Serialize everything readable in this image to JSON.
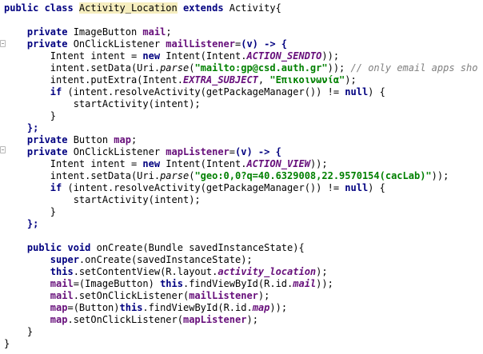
{
  "editor": {
    "language": "java",
    "colors": {
      "keyword": "#000080",
      "field": "#660e7a",
      "string": "#008000",
      "comment": "#808080",
      "highlight": "#f6eebf",
      "background": "#ffffff"
    },
    "lines": [
      [
        [
          "kw",
          "public class "
        ],
        [
          "hl",
          "Activity_Location"
        ],
        [
          "kw",
          " extends "
        ],
        [
          "",
          "Activity{"
        ]
      ],
      [],
      [
        [
          "",
          "    "
        ],
        [
          "kw",
          "private "
        ],
        [
          "",
          "ImageButton "
        ],
        [
          "fld",
          "mail"
        ],
        [
          ";"
        ]
      ],
      [
        [
          "",
          "    "
        ],
        [
          "kw",
          "private "
        ],
        [
          "",
          "OnClickListener "
        ],
        [
          "fld",
          "mailListener"
        ],
        [
          "",
          "="
        ],
        [
          "kw",
          "(v) -> {"
        ]
      ],
      [
        [
          "",
          "        Intent intent = "
        ],
        [
          "kw",
          "new "
        ],
        [
          "",
          "Intent(Intent."
        ],
        [
          "cst",
          "ACTION_SENDTO"
        ],
        [
          "",
          "));"
        ]
      ],
      [
        [
          "",
          "        intent.setData(Uri."
        ],
        [
          "sm",
          "parse"
        ],
        [
          "",
          "("
        ],
        [
          "str",
          "\"mailto:gp@csd.auth.gr\""
        ],
        [
          "",
          "));"
        ],
        [
          "cmt",
          " // only email apps sho"
        ]
      ],
      [
        [
          "",
          "        intent.putExtra(Intent."
        ],
        [
          "cst",
          "EXTRA_SUBJECT"
        ],
        [
          "",
          ", "
        ],
        [
          "str",
          "\"Επικοινωνία\""
        ],
        [
          "",
          ");"
        ]
      ],
      [
        [
          "",
          "        "
        ],
        [
          "kw",
          "if "
        ],
        [
          "",
          "(intent.resolveActivity(getPackageManager()) != "
        ],
        [
          "kw",
          "null"
        ],
        [
          "",
          ") {"
        ]
      ],
      [
        [
          "",
          "            startActivity(intent);"
        ]
      ],
      [
        [
          "",
          "        }"
        ]
      ],
      [
        [
          "",
          "    "
        ],
        [
          "kw",
          "};"
        ]
      ],
      [
        [
          "",
          "    "
        ],
        [
          "kw",
          "private "
        ],
        [
          "",
          "Button "
        ],
        [
          "fld",
          "map"
        ],
        [
          ";"
        ]
      ],
      [
        [
          "",
          "    "
        ],
        [
          "kw",
          "private "
        ],
        [
          "",
          "OnClickListener "
        ],
        [
          "fld",
          "mapListener"
        ],
        [
          "",
          "="
        ],
        [
          "kw",
          "(v) -> {"
        ]
      ],
      [
        [
          "",
          "        Intent intent = "
        ],
        [
          "kw",
          "new "
        ],
        [
          "",
          "Intent(Intent."
        ],
        [
          "cst",
          "ACTION_VIEW"
        ],
        [
          "",
          "));"
        ]
      ],
      [
        [
          "",
          "        intent.setData(Uri."
        ],
        [
          "sm",
          "parse"
        ],
        [
          "",
          "("
        ],
        [
          "str",
          "\"geo:0,0?q=40.6329008,22.9570154(cacLab)\""
        ],
        [
          "",
          "));"
        ]
      ],
      [
        [
          "",
          "        "
        ],
        [
          "kw",
          "if "
        ],
        [
          "",
          "(intent.resolveActivity(getPackageManager()) != "
        ],
        [
          "kw",
          "null"
        ],
        [
          "",
          ") {"
        ]
      ],
      [
        [
          "",
          "            startActivity(intent);"
        ]
      ],
      [
        [
          "",
          "        }"
        ]
      ],
      [
        [
          "",
          "    "
        ],
        [
          "kw",
          "};"
        ]
      ],
      [],
      [
        [
          "",
          "    "
        ],
        [
          "kw",
          "public void "
        ],
        [
          "",
          "onCreate(Bundle savedInstanceState){"
        ]
      ],
      [
        [
          "",
          "        "
        ],
        [
          "kw",
          "super"
        ],
        [
          "",
          ".onCreate(savedInstanceState);"
        ]
      ],
      [
        [
          "",
          "        "
        ],
        [
          "kw",
          "this"
        ],
        [
          "",
          ".setContentView(R.layout."
        ],
        [
          "cst",
          "activity_location"
        ],
        [
          "",
          ");"
        ]
      ],
      [
        [
          "",
          "        "
        ],
        [
          "fld",
          "mail"
        ],
        [
          "",
          "=(ImageButton) "
        ],
        [
          "kw",
          "this"
        ],
        [
          "",
          ".findViewById(R.id."
        ],
        [
          "cst",
          "mail"
        ],
        [
          "",
          "));"
        ]
      ],
      [
        [
          "",
          "        "
        ],
        [
          "fld",
          "mail"
        ],
        [
          "",
          ".setOnClickListener("
        ],
        [
          "fld",
          "mailListener"
        ],
        [
          "",
          ");"
        ]
      ],
      [
        [
          "",
          "        "
        ],
        [
          "fld",
          "map"
        ],
        [
          "",
          "=(Button)"
        ],
        [
          "kw",
          "this"
        ],
        [
          "",
          ".findViewById(R.id."
        ],
        [
          "cst",
          "map"
        ],
        [
          "",
          "));"
        ]
      ],
      [
        [
          "",
          "        "
        ],
        [
          "fld",
          "map"
        ],
        [
          "",
          ".setOnClickListener("
        ],
        [
          "fld",
          "mapListener"
        ],
        [
          "",
          ");"
        ]
      ],
      [
        [
          "",
          "    }"
        ]
      ],
      [
        [
          "",
          "}"
        ]
      ]
    ]
  }
}
